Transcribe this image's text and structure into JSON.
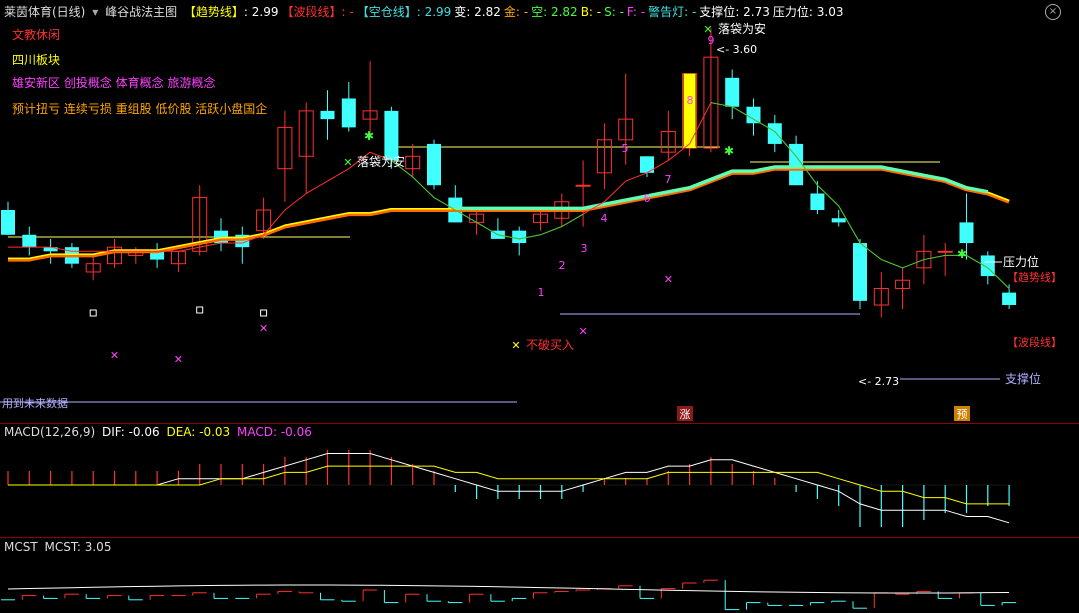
{
  "header": {
    "stock_name": "莱茵体育(日线)",
    "indicator_name": "峰谷战法主图",
    "items": [
      {
        "label": "【趋势线】",
        "value": ": 2.99",
        "label_color": "#ffff00",
        "value_color": "#ffffff"
      },
      {
        "label": "【波段线】",
        "value": ": -",
        "label_color": "#ff3030",
        "value_color": "#ff3030"
      },
      {
        "label": "【空仓线】",
        "value": ": 2.99",
        "label_color": "#40e0e0",
        "value_color": "#40e0e0"
      },
      {
        "label": "变",
        "value": ": 2.82",
        "label_color": "#ffffff",
        "value_color": "#ffffff"
      },
      {
        "label": "金",
        "value": ": -",
        "label_color": "#ffa500",
        "value_color": "#ffa500"
      },
      {
        "label": "空",
        "value": ": 2.82",
        "label_color": "#40ff40",
        "value_color": "#40ff40"
      },
      {
        "label": "B",
        "value": ": -",
        "label_color": "#ffff00",
        "value_color": "#ffff00"
      },
      {
        "label": "S",
        "value": ": -",
        "label_color": "#40ff40",
        "value_color": "#40ff40"
      },
      {
        "label": "F",
        "value": ": -",
        "label_color": "#ff40ff",
        "value_color": "#ff40ff"
      },
      {
        "label": "警告灯",
        "value": ": -",
        "label_color": "#40e0e0",
        "value_color": "#40e0e0"
      },
      {
        "label": "支撑位",
        "value": ": 2.73",
        "label_color": "#ffffff",
        "value_color": "#ffffff"
      },
      {
        "label": "压力位",
        "value": ": 3.03",
        "label_color": "#ffffff",
        "value_color": "#ffffff"
      }
    ]
  },
  "concepts": [
    {
      "text": "文教休闲",
      "color": "#ff3030"
    },
    {
      "text": "四川板块",
      "color": "#ffff00"
    },
    {
      "text": "雄安新区 创投概念 体育概念 旅游概念",
      "color": "#ff40ff"
    },
    {
      "text": "预计扭亏 连续亏损 重组股 低价股 活跃小盘国企",
      "color": "#ffa500"
    }
  ],
  "annotations": {
    "luodai1": "落袋为安",
    "luodai2": "落袋为安",
    "bupo": "不破买入",
    "high_price": "3.60",
    "low_price": "2.73",
    "pressure": "压力位",
    "support": "支撑位",
    "trend_tag": "【趋势线】",
    "wave_tag": "【波段线】",
    "future_data": "用到未来数据",
    "zhang": "涨",
    "yu": "预",
    "seq": [
      "1",
      "2",
      "3",
      "4",
      "5",
      "6",
      "7",
      "8",
      "9"
    ]
  },
  "macd": {
    "title": "MACD(12,26,9)",
    "dif": "DIF: -0.06",
    "dea": "DEA: -0.03",
    "macd": "MACD: -0.06"
  },
  "mcst": {
    "title": "MCST",
    "value": "MCST: 3.05"
  },
  "colors": {
    "up": "#ff3030",
    "down": "#40ffff",
    "trend": "#ffff00",
    "wave": "#ff3030",
    "empty": "#40e0e0"
  },
  "chart_data": {
    "type": "candlestick",
    "candles": [
      {
        "o": 3.16,
        "h": 3.18,
        "l": 3.1,
        "c": 3.1
      },
      {
        "o": 3.1,
        "h": 3.12,
        "l": 3.05,
        "c": 3.07
      },
      {
        "o": 3.07,
        "h": 3.09,
        "l": 3.03,
        "c": 3.06
      },
      {
        "o": 3.07,
        "h": 3.08,
        "l": 3.02,
        "c": 3.03
      },
      {
        "o": 3.01,
        "h": 3.05,
        "l": 2.99,
        "c": 3.03
      },
      {
        "o": 3.03,
        "h": 3.09,
        "l": 3.02,
        "c": 3.07
      },
      {
        "o": 3.05,
        "h": 3.07,
        "l": 3.03,
        "c": 3.06
      },
      {
        "o": 3.06,
        "h": 3.08,
        "l": 3.02,
        "c": 3.04
      },
      {
        "o": 3.03,
        "h": 3.06,
        "l": 3.01,
        "c": 3.06
      },
      {
        "o": 3.06,
        "h": 3.22,
        "l": 3.05,
        "c": 3.19
      },
      {
        "o": 3.11,
        "h": 3.14,
        "l": 3.06,
        "c": 3.08
      },
      {
        "o": 3.1,
        "h": 3.12,
        "l": 3.03,
        "c": 3.07
      },
      {
        "o": 3.11,
        "h": 3.19,
        "l": 3.09,
        "c": 3.16
      },
      {
        "o": 3.26,
        "h": 3.4,
        "l": 3.18,
        "c": 3.36
      },
      {
        "o": 3.29,
        "h": 3.42,
        "l": 3.2,
        "c": 3.4
      },
      {
        "o": 3.4,
        "h": 3.45,
        "l": 3.33,
        "c": 3.38
      },
      {
        "o": 3.43,
        "h": 3.47,
        "l": 3.35,
        "c": 3.36
      },
      {
        "o": 3.38,
        "h": 3.52,
        "l": 3.34,
        "c": 3.4
      },
      {
        "o": 3.4,
        "h": 3.41,
        "l": 3.26,
        "c": 3.28
      },
      {
        "o": 3.26,
        "h": 3.32,
        "l": 3.24,
        "c": 3.29
      },
      {
        "o": 3.32,
        "h": 3.33,
        "l": 3.21,
        "c": 3.22
      },
      {
        "o": 3.19,
        "h": 3.22,
        "l": 3.13,
        "c": 3.13
      },
      {
        "o": 3.13,
        "h": 3.16,
        "l": 3.1,
        "c": 3.15
      },
      {
        "o": 3.11,
        "h": 3.14,
        "l": 3.09,
        "c": 3.09
      },
      {
        "o": 3.11,
        "h": 3.12,
        "l": 3.05,
        "c": 3.08
      },
      {
        "o": 3.13,
        "h": 3.16,
        "l": 3.11,
        "c": 3.15
      },
      {
        "o": 3.14,
        "h": 3.2,
        "l": 3.12,
        "c": 3.18
      },
      {
        "o": 3.22,
        "h": 3.28,
        "l": 3.12,
        "c": 3.22
      },
      {
        "o": 3.25,
        "h": 3.37,
        "l": 3.21,
        "c": 3.33
      },
      {
        "o": 3.33,
        "h": 3.49,
        "l": 3.27,
        "c": 3.38
      },
      {
        "o": 3.29,
        "h": 3.26,
        "l": 3.24,
        "c": 3.25
      },
      {
        "o": 3.3,
        "h": 3.4,
        "l": 3.28,
        "c": 3.35
      },
      {
        "o": 3.31,
        "h": 3.43,
        "l": 3.29,
        "c": 3.49
      },
      {
        "o": 3.31,
        "h": 3.6,
        "l": 3.3,
        "c": 3.53
      },
      {
        "o": 3.48,
        "h": 3.5,
        "l": 3.38,
        "c": 3.41
      },
      {
        "o": 3.41,
        "h": 3.43,
        "l": 3.34,
        "c": 3.37
      },
      {
        "o": 3.37,
        "h": 3.39,
        "l": 3.3,
        "c": 3.32
      },
      {
        "o": 3.32,
        "h": 3.34,
        "l": 3.22,
        "c": 3.22
      },
      {
        "o": 3.2,
        "h": 3.23,
        "l": 3.15,
        "c": 3.16
      },
      {
        "o": 3.14,
        "h": 3.16,
        "l": 3.12,
        "c": 3.13
      },
      {
        "o": 3.08,
        "h": 3.09,
        "l": 2.92,
        "c": 2.94
      },
      {
        "o": 2.93,
        "h": 3.01,
        "l": 2.9,
        "c": 2.97
      },
      {
        "o": 2.97,
        "h": 3.02,
        "l": 2.92,
        "c": 2.99
      },
      {
        "o": 3.02,
        "h": 3.1,
        "l": 2.98,
        "c": 3.06
      },
      {
        "o": 3.06,
        "h": 3.08,
        "l": 3.0,
        "c": 3.06
      },
      {
        "o": 3.13,
        "h": 3.2,
        "l": 3.04,
        "c": 3.08
      },
      {
        "o": 3.05,
        "h": 3.06,
        "l": 2.98,
        "c": 3.0
      },
      {
        "o": 2.96,
        "h": 2.98,
        "l": 2.92,
        "c": 2.93
      }
    ],
    "trend_line": [
      3.04,
      3.04,
      3.05,
      3.05,
      3.05,
      3.06,
      3.06,
      3.06,
      3.07,
      3.08,
      3.09,
      3.09,
      3.1,
      3.12,
      3.13,
      3.14,
      3.15,
      3.15,
      3.16,
      3.16,
      3.16,
      3.16,
      3.16,
      3.16,
      3.16,
      3.16,
      3.16,
      3.16,
      3.17,
      3.18,
      3.19,
      3.2,
      3.21,
      3.23,
      3.25,
      3.25,
      3.26,
      3.26,
      3.26,
      3.26,
      3.26,
      3.26,
      3.25,
      3.24,
      3.23,
      3.21,
      3.2,
      3.18
    ],
    "wave_line": [
      3.07,
      3.07,
      3.07,
      3.06,
      3.06,
      3.06,
      3.06,
      3.06,
      3.06,
      3.07,
      3.08,
      3.08,
      3.1,
      3.16,
      3.2,
      3.23,
      3.26,
      3.3,
      3.28,
      3.24,
      3.19,
      3.16,
      3.13,
      3.1,
      3.09,
      3.1,
      3.12,
      3.15,
      3.18,
      3.23,
      3.25,
      3.28,
      3.32,
      3.42,
      3.41,
      3.38,
      3.35,
      3.29,
      3.22,
      3.17,
      3.08,
      3.04,
      3.02,
      3.04,
      3.05,
      3.05,
      3.02,
      2.97
    ],
    "ylim": [
      2.7,
      3.62
    ],
    "macd_hist": [
      0.02,
      0.02,
      0.02,
      0.02,
      0.02,
      0.02,
      0.02,
      0.02,
      0.02,
      0.03,
      0.03,
      0.03,
      0.03,
      0.04,
      0.04,
      0.05,
      0.05,
      0.05,
      0.04,
      0.03,
      0.02,
      -0.01,
      -0.02,
      -0.02,
      -0.02,
      -0.02,
      -0.02,
      -0.01,
      0.01,
      0.01,
      0.01,
      0.02,
      0.03,
      0.04,
      0.03,
      0.02,
      0.01,
      -0.01,
      -0.02,
      -0.03,
      -0.06,
      -0.06,
      -0.06,
      -0.05,
      -0.04,
      -0.04,
      -0.03,
      -0.03
    ],
    "macd_dif": [
      0.0,
      0.0,
      0.0,
      0.0,
      0.0,
      0.0,
      0.0,
      0.0,
      0.01,
      0.01,
      0.01,
      0.01,
      0.02,
      0.03,
      0.04,
      0.05,
      0.05,
      0.05,
      0.04,
      0.03,
      0.02,
      0.01,
      0.0,
      -0.01,
      -0.01,
      -0.01,
      -0.01,
      0.0,
      0.01,
      0.02,
      0.02,
      0.03,
      0.03,
      0.04,
      0.04,
      0.03,
      0.02,
      0.01,
      0.0,
      -0.01,
      -0.03,
      -0.04,
      -0.04,
      -0.04,
      -0.04,
      -0.05,
      -0.05,
      -0.06
    ],
    "macd_dea": [
      0.0,
      0.0,
      0.0,
      0.0,
      0.0,
      0.0,
      0.0,
      0.0,
      0.0,
      0.0,
      0.01,
      0.01,
      0.01,
      0.02,
      0.02,
      0.03,
      0.03,
      0.03,
      0.03,
      0.03,
      0.03,
      0.02,
      0.02,
      0.01,
      0.01,
      0.01,
      0.01,
      0.01,
      0.01,
      0.01,
      0.01,
      0.02,
      0.02,
      0.02,
      0.02,
      0.02,
      0.02,
      0.02,
      0.02,
      0.01,
      0.0,
      -0.01,
      -0.01,
      -0.02,
      -0.02,
      -0.03,
      -0.03,
      -0.03
    ],
    "mcst_bars": [
      -0.2,
      0.1,
      -0.1,
      0.2,
      -0.1,
      0.1,
      -0.2,
      0.1,
      0.1,
      0.3,
      -0.1,
      -0.1,
      0.2,
      0.4,
      0.3,
      -0.2,
      -0.3,
      0.5,
      -0.4,
      0.2,
      -0.3,
      -0.4,
      0.2,
      -0.3,
      -0.1,
      0.3,
      0.4,
      0.5,
      0.6,
      0.8,
      -0.1,
      0.6,
      1.0,
      1.2,
      -0.9,
      -0.4,
      -0.6,
      -0.6,
      -0.4,
      -0.3,
      -0.8,
      0.3,
      0.2,
      0.4,
      -0.1,
      0.3,
      -0.6,
      -0.4
    ]
  }
}
